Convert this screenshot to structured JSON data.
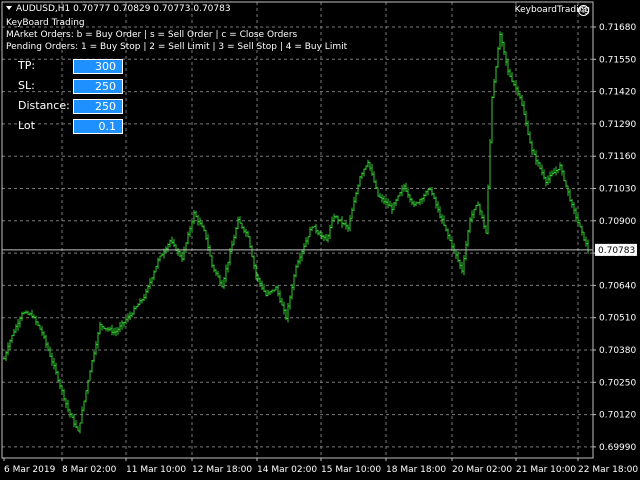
{
  "header": {
    "symbol_line": "AUDUSD,H1  0.70777 0.70829 0.70773 0.70783",
    "expert_name": "KeyboardTrading",
    "title": "KeyBoard Trading",
    "market_orders": "MArket Orders: b = Buy Order  |  s = Sell Order  |  c = Close Orders",
    "pending_orders": "Pending Orders: 1 = Buy Stop  |  2 = Sell Limit  |  3 = Sell Stop  |  4 = Buy Limit"
  },
  "panel": {
    "tp_label": "TP:",
    "tp_value": "300",
    "sl_label": "SL:",
    "sl_value": "250",
    "distance_label": "Distance:",
    "distance_value": "250",
    "lot_label": "Lot",
    "lot_value": "0.1"
  },
  "colors": {
    "background": "#000000",
    "candle": "#32cd32",
    "grid": "#c0c0c0",
    "field": "#1e90ff"
  },
  "chart_data": {
    "type": "bar",
    "current_price": "0.70783",
    "y_ticks": [
      "0.71680",
      "0.71550",
      "0.71420",
      "0.71290",
      "0.71160",
      "0.71030",
      "0.70900",
      "0.70764",
      "0.70640",
      "0.70510",
      "0.70380",
      "0.70250",
      "0.70120",
      "0.69990"
    ],
    "x_ticks": [
      "6 Mar 2019",
      "8 Mar 02:00",
      "11 Mar 10:00",
      "12 Mar 18:00",
      "14 Mar 02:00",
      "15 Mar 10:00",
      "18 Mar 18:00",
      "20 Mar 02:00",
      "21 Mar 10:00",
      "22 Mar 18:00"
    ],
    "ylim": [
      0.6999,
      0.7176
    ],
    "grid": true,
    "close_path": [
      [
        0,
        0.7029
      ],
      [
        8,
        0.704
      ],
      [
        22,
        0.7053
      ],
      [
        32,
        0.7052
      ],
      [
        42,
        0.7045
      ],
      [
        55,
        0.703
      ],
      [
        68,
        0.7014
      ],
      [
        78,
        0.7005
      ],
      [
        90,
        0.703
      ],
      [
        100,
        0.7048
      ],
      [
        115,
        0.7045
      ],
      [
        130,
        0.7052
      ],
      [
        145,
        0.706
      ],
      [
        158,
        0.7074
      ],
      [
        170,
        0.7082
      ],
      [
        182,
        0.7075
      ],
      [
        194,
        0.7093
      ],
      [
        205,
        0.7085
      ],
      [
        212,
        0.7072
      ],
      [
        222,
        0.7064
      ],
      [
        238,
        0.709
      ],
      [
        248,
        0.7084
      ],
      [
        256,
        0.7068
      ],
      [
        266,
        0.706
      ],
      [
        276,
        0.7063
      ],
      [
        286,
        0.7051
      ],
      [
        296,
        0.7072
      ],
      [
        312,
        0.7088
      ],
      [
        326,
        0.7082
      ],
      [
        334,
        0.7092
      ],
      [
        348,
        0.7087
      ],
      [
        360,
        0.7108
      ],
      [
        368,
        0.7114
      ],
      [
        378,
        0.71
      ],
      [
        392,
        0.7095
      ],
      [
        404,
        0.7104
      ],
      [
        414,
        0.7096
      ],
      [
        430,
        0.7103
      ],
      [
        440,
        0.7092
      ],
      [
        452,
        0.708
      ],
      [
        462,
        0.707
      ],
      [
        470,
        0.7091
      ],
      [
        478,
        0.7097
      ],
      [
        486,
        0.7085
      ],
      [
        492,
        0.714
      ],
      [
        500,
        0.7165
      ],
      [
        508,
        0.715
      ],
      [
        520,
        0.714
      ],
      [
        532,
        0.7118
      ],
      [
        546,
        0.7106
      ],
      [
        560,
        0.7112
      ],
      [
        572,
        0.7096
      ],
      [
        588,
        0.70783
      ]
    ]
  }
}
